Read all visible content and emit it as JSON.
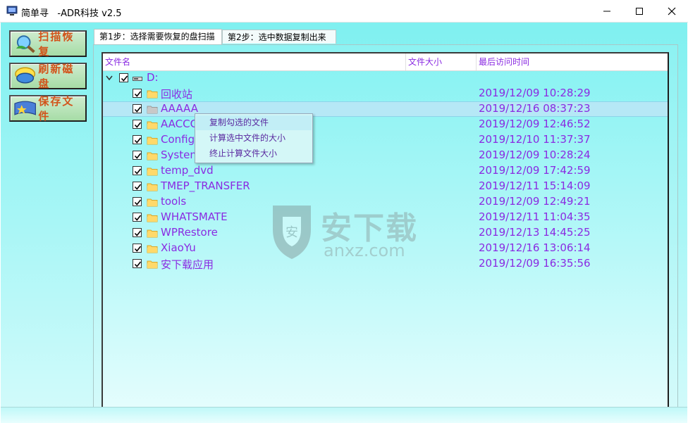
{
  "window": {
    "title": "简单寻   -ADR科技 v2.5",
    "minimize_icon": "minimize-icon",
    "maximize_icon": "maximize-icon",
    "close_icon": "close-icon"
  },
  "sidebar": {
    "items": [
      {
        "label": "扫描恢复",
        "icon": "scan-icon"
      },
      {
        "label": "刷新磁盘",
        "icon": "refresh-disk-icon"
      },
      {
        "label": "保存文件",
        "icon": "save-file-icon"
      }
    ]
  },
  "tabs": [
    {
      "label": "第1步：选择需要恢复的盘扫描",
      "active": true
    },
    {
      "label": "第2步：选中数据复制出来",
      "active": false
    }
  ],
  "table": {
    "columns": [
      "文件名",
      "文件大小",
      "最后访问时间"
    ],
    "drive": {
      "label": "D:",
      "checked": true,
      "expanded": true
    },
    "rows": [
      {
        "name": "回收站",
        "size": "",
        "time": "2019/12/09 10:28:29",
        "checked": true,
        "selected": false
      },
      {
        "name": "AAAAA",
        "size": "",
        "time": "2019/12/16 08:37:23",
        "checked": true,
        "selected": true
      },
      {
        "name": "AACCC",
        "size": "",
        "time": "2019/12/09 12:46:52",
        "checked": true,
        "selected": false
      },
      {
        "name": "Config",
        "size": "",
        "time": "2019/12/10 11:37:37",
        "checked": true,
        "selected": false
      },
      {
        "name": "System",
        "size": "",
        "time": "2019/12/09 10:28:24",
        "checked": true,
        "selected": false
      },
      {
        "name": "temp_dvd",
        "size": "",
        "time": "2019/12/09 17:42:59",
        "checked": true,
        "selected": false
      },
      {
        "name": "TMEP_TRANSFER",
        "size": "",
        "time": "2019/12/11 15:14:09",
        "checked": true,
        "selected": false
      },
      {
        "name": "tools",
        "size": "",
        "time": "2019/12/09 12:49:21",
        "checked": true,
        "selected": false
      },
      {
        "name": "WHATSMATE",
        "size": "",
        "time": "2019/12/11 11:04:35",
        "checked": true,
        "selected": false
      },
      {
        "name": "WPRestore",
        "size": "",
        "time": "2019/12/13 14:45:25",
        "checked": true,
        "selected": false
      },
      {
        "name": "XiaoYu",
        "size": "",
        "time": "2019/12/16 13:06:14",
        "checked": true,
        "selected": false
      },
      {
        "name": "安下载应用",
        "size": "",
        "time": "2019/12/09 16:35:56",
        "checked": true,
        "selected": false
      }
    ]
  },
  "context_menu": {
    "items": [
      "复制勾选的文件",
      "计算选中文件的大小",
      "终止计算文件大小"
    ]
  },
  "watermark": {
    "title": "安下载",
    "subtitle": "anxz.com"
  },
  "colors": {
    "accent_text": "#8a2be2",
    "button_text": "#d2541b",
    "background": "#7ff0f0"
  }
}
